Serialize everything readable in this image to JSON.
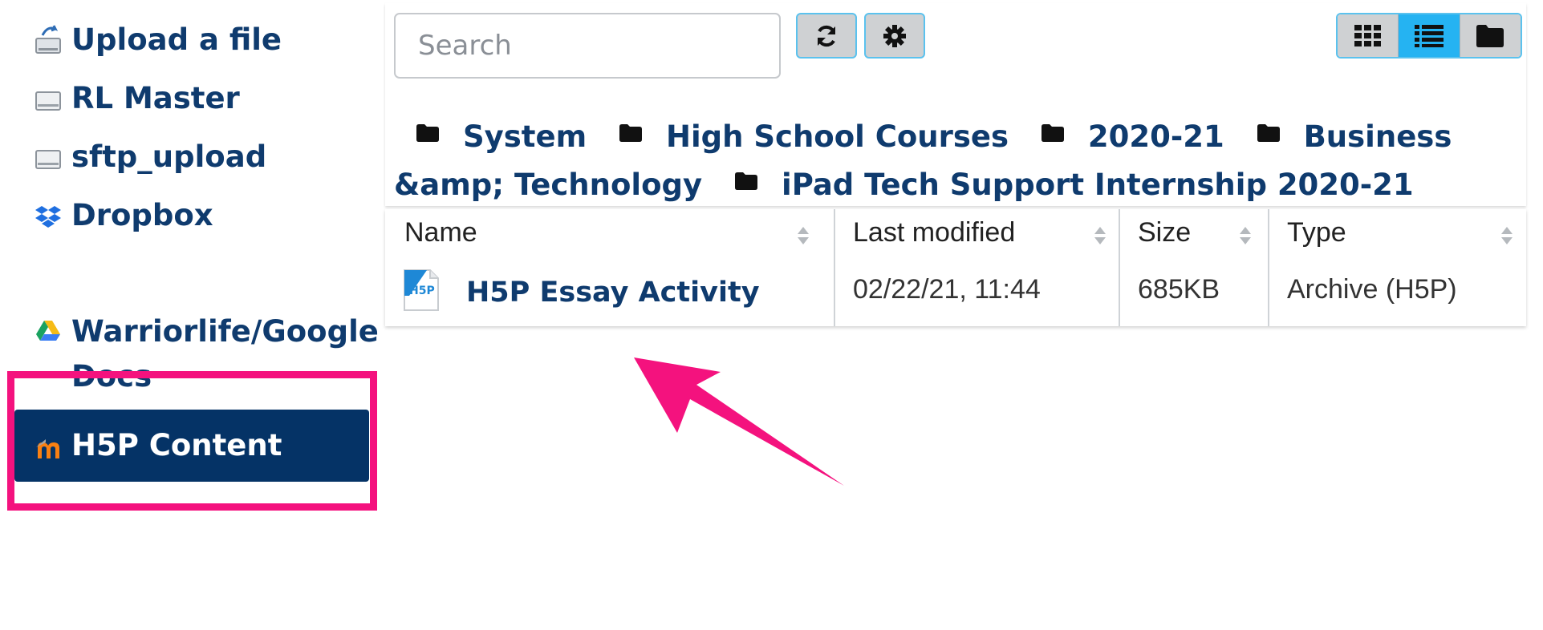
{
  "sidebar": {
    "items": [
      {
        "label": "Upload a file",
        "icon": "upload-icon"
      },
      {
        "label": "RL Master",
        "icon": "server-icon"
      },
      {
        "label": "sftp_upload",
        "icon": "server-icon"
      },
      {
        "label": "Dropbox",
        "icon": "dropbox-icon"
      },
      {
        "label": "Warriorlife/Google Docs",
        "icon": "google-drive-icon"
      },
      {
        "label": "H5P Content",
        "icon": "h5p-moodle-icon",
        "active": true
      }
    ],
    "highlight_color": "#f4127e",
    "active_bg": "#053366"
  },
  "toolbar": {
    "search_placeholder": "Search",
    "refresh_icon": "refresh-icon",
    "settings_icon": "gear-icon",
    "views": [
      {
        "icon": "grid-icon",
        "active": false
      },
      {
        "icon": "list-icon",
        "active": true
      },
      {
        "icon": "folder-icon",
        "active": false
      }
    ],
    "accent": "#25b3f2"
  },
  "breadcrumb": [
    "System",
    "High School Courses",
    "2020-21",
    "Business &amp; Technology",
    "iPad Tech Support Internship 2020-21"
  ],
  "table": {
    "headers": [
      "Name",
      "Last modified",
      "Size",
      "Type"
    ],
    "rows": [
      {
        "name": "H5P Essay Activity",
        "modified": "02/22/21, 11:44",
        "size": "685KB",
        "type": "Archive (H5P)",
        "icon": "h5p-file-icon"
      }
    ]
  },
  "annotation": {
    "arrow_color": "#f4127e"
  }
}
